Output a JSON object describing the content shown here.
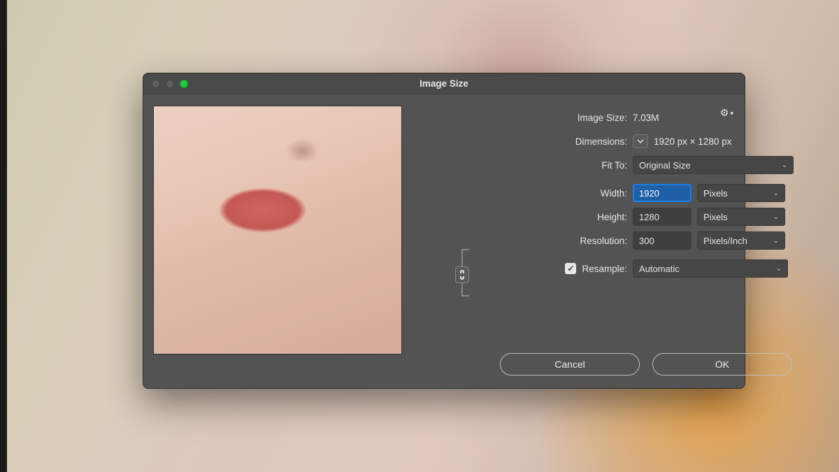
{
  "dialog": {
    "title": "Image Size",
    "imageSize": {
      "label": "Image Size:",
      "value": "7.03M"
    },
    "dimensions": {
      "label": "Dimensions:",
      "value": "1920 px  ×  1280 px"
    },
    "fitTo": {
      "label": "Fit To:",
      "value": "Original Size"
    },
    "width": {
      "label": "Width:",
      "value": "1920",
      "unit": "Pixels"
    },
    "height": {
      "label": "Height:",
      "value": "1280",
      "unit": "Pixels"
    },
    "resolution": {
      "label": "Resolution:",
      "value": "300",
      "unit": "Pixels/Inch"
    },
    "resample": {
      "label": "Resample:",
      "checked": true,
      "mode": "Automatic"
    },
    "buttons": {
      "cancel": "Cancel",
      "ok": "OK"
    }
  }
}
